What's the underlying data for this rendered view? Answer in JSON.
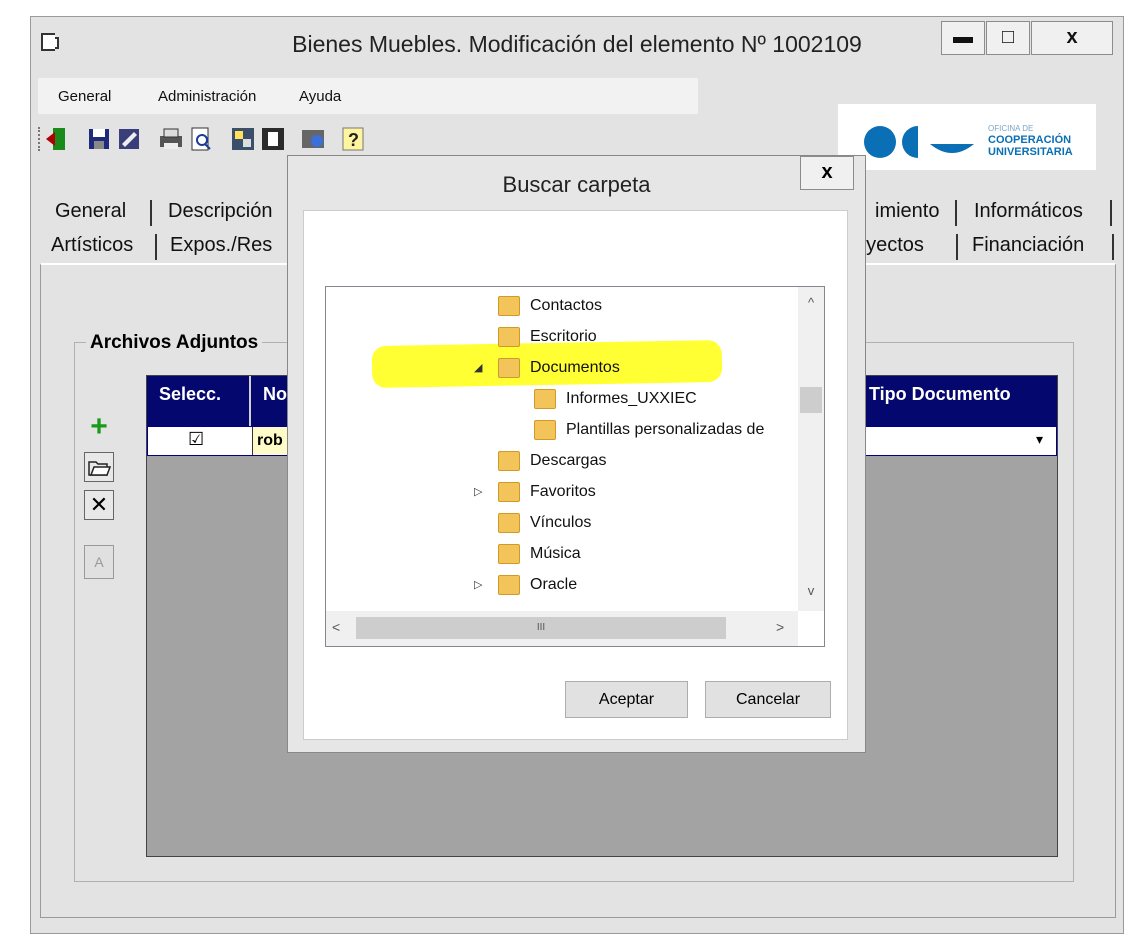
{
  "window": {
    "title": "Bienes Muebles. Modificación del elemento Nº 1002109",
    "minimize": "▬",
    "maximize": "□",
    "close": "x"
  },
  "menu": [
    "General",
    "Administración",
    "Ayuda"
  ],
  "logo": {
    "line1": "OFICINA DE",
    "line2": "COOPERACIÓN",
    "line3": "UNIVERSITARIA",
    "color": "#0a6fb5"
  },
  "tabs": {
    "row1": [
      "General",
      "Descripción",
      "imiento",
      "Informáticos"
    ],
    "row2": [
      "Artísticos",
      "Expos./Res",
      "oyectos",
      "Financiación"
    ]
  },
  "attachments": {
    "legend": "Archivos Adjuntos",
    "columns": [
      "Selecc.",
      "No",
      "Tipo Documento"
    ],
    "row": {
      "checked": "☑",
      "name": "rob",
      "type_arrow": "▾"
    }
  },
  "side_buttons": {
    "add": "+",
    "open": "📂",
    "delete": "✕",
    "other": "A"
  },
  "dialog": {
    "title": "Buscar carpeta",
    "close": "x",
    "tree": [
      {
        "label": "Contactos",
        "expander": "",
        "indent": 0
      },
      {
        "label": "Escritorio",
        "expander": "",
        "indent": 0
      },
      {
        "label": "Documentos",
        "expander": "◢",
        "indent": 0,
        "highlight": true
      },
      {
        "label": "Informes_UXXIEC",
        "expander": "",
        "indent": 1
      },
      {
        "label": "Plantillas personalizadas de",
        "expander": "",
        "indent": 1
      },
      {
        "label": "Descargas",
        "expander": "",
        "indent": 0
      },
      {
        "label": "Favoritos",
        "expander": "▷",
        "indent": 0
      },
      {
        "label": "Vínculos",
        "expander": "",
        "indent": 0
      },
      {
        "label": "Música",
        "expander": "",
        "indent": 0
      },
      {
        "label": "Oracle",
        "expander": "▷",
        "indent": 0
      }
    ],
    "scroll_up": "^",
    "scroll_down": "v",
    "scroll_left": "<",
    "scroll_right": ">",
    "scroll_grip": "III",
    "ok": "Aceptar",
    "cancel": "Cancelar"
  },
  "colors": {
    "highlight": "#ffff33",
    "grid_header": "#04076e"
  }
}
